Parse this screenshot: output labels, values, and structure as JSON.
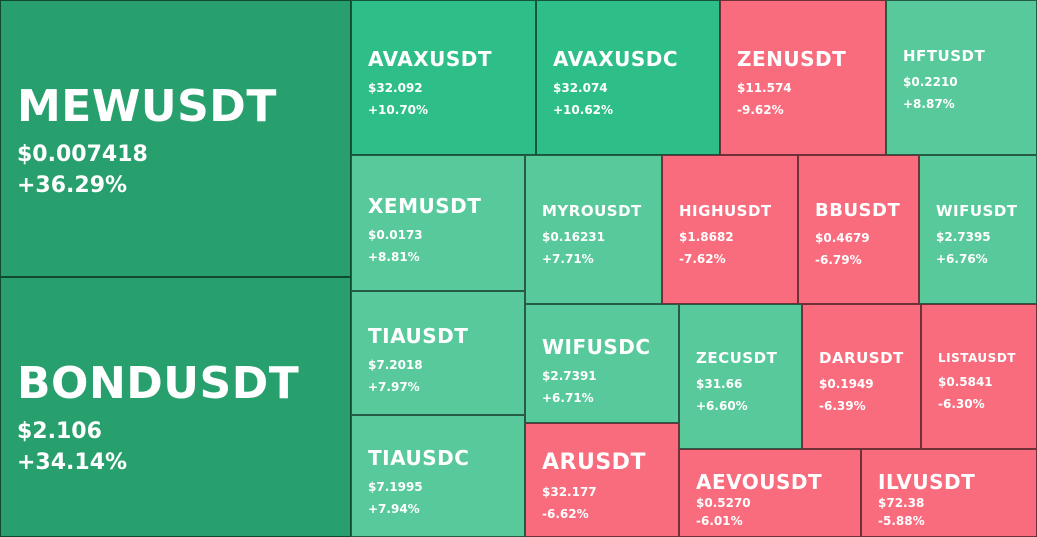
{
  "tiles": [
    {
      "symbol": "MEWUSDT",
      "price": "$0.007418",
      "change": "+36.29%"
    },
    {
      "symbol": "BONDUSDT",
      "price": "$2.106",
      "change": "+34.14%"
    },
    {
      "symbol": "AVAXUSDT",
      "price": "$32.092",
      "change": "+10.70%"
    },
    {
      "symbol": "AVAXUSDC",
      "price": "$32.074",
      "change": "+10.62%"
    },
    {
      "symbol": "ZENUSDT",
      "price": "$11.574",
      "change": "-9.62%"
    },
    {
      "symbol": "HFTUSDT",
      "price": "$0.2210",
      "change": "+8.87%"
    },
    {
      "symbol": "XEMUSDT",
      "price": "$0.0173",
      "change": "+8.81%"
    },
    {
      "symbol": "MYROUSDT",
      "price": "$0.16231",
      "change": "+7.71%"
    },
    {
      "symbol": "HIGHUSDT",
      "price": "$1.8682",
      "change": "-7.62%"
    },
    {
      "symbol": "BBUSDT",
      "price": "$0.4679",
      "change": "-6.79%"
    },
    {
      "symbol": "WIFUSDT",
      "price": "$2.7395",
      "change": "+6.76%"
    },
    {
      "symbol": "TIAUSDT",
      "price": "$7.2018",
      "change": "+7.97%"
    },
    {
      "symbol": "WIFUSDC",
      "price": "$2.7391",
      "change": "+6.71%"
    },
    {
      "symbol": "ZECUSDT",
      "price": "$31.66",
      "change": "+6.60%"
    },
    {
      "symbol": "DARUSDT",
      "price": "$0.1949",
      "change": "-6.39%"
    },
    {
      "symbol": "LISTAUSDT",
      "price": "$0.5841",
      "change": "-6.30%"
    },
    {
      "symbol": "TIAUSDC",
      "price": "$7.1995",
      "change": "+7.94%"
    },
    {
      "symbol": "ARUSDT",
      "price": "$32.177",
      "change": "-6.62%"
    },
    {
      "symbol": "AEVOUSDT",
      "price": "$0.5270",
      "change": "-6.01%"
    },
    {
      "symbol": "ILVUSDT",
      "price": "$72.38",
      "change": "-5.88%"
    }
  ],
  "colors": {
    "dark_green": "#27a06d",
    "green": "#2ebf88",
    "light_green": "#58c99b",
    "red": "#f86c7d"
  }
}
